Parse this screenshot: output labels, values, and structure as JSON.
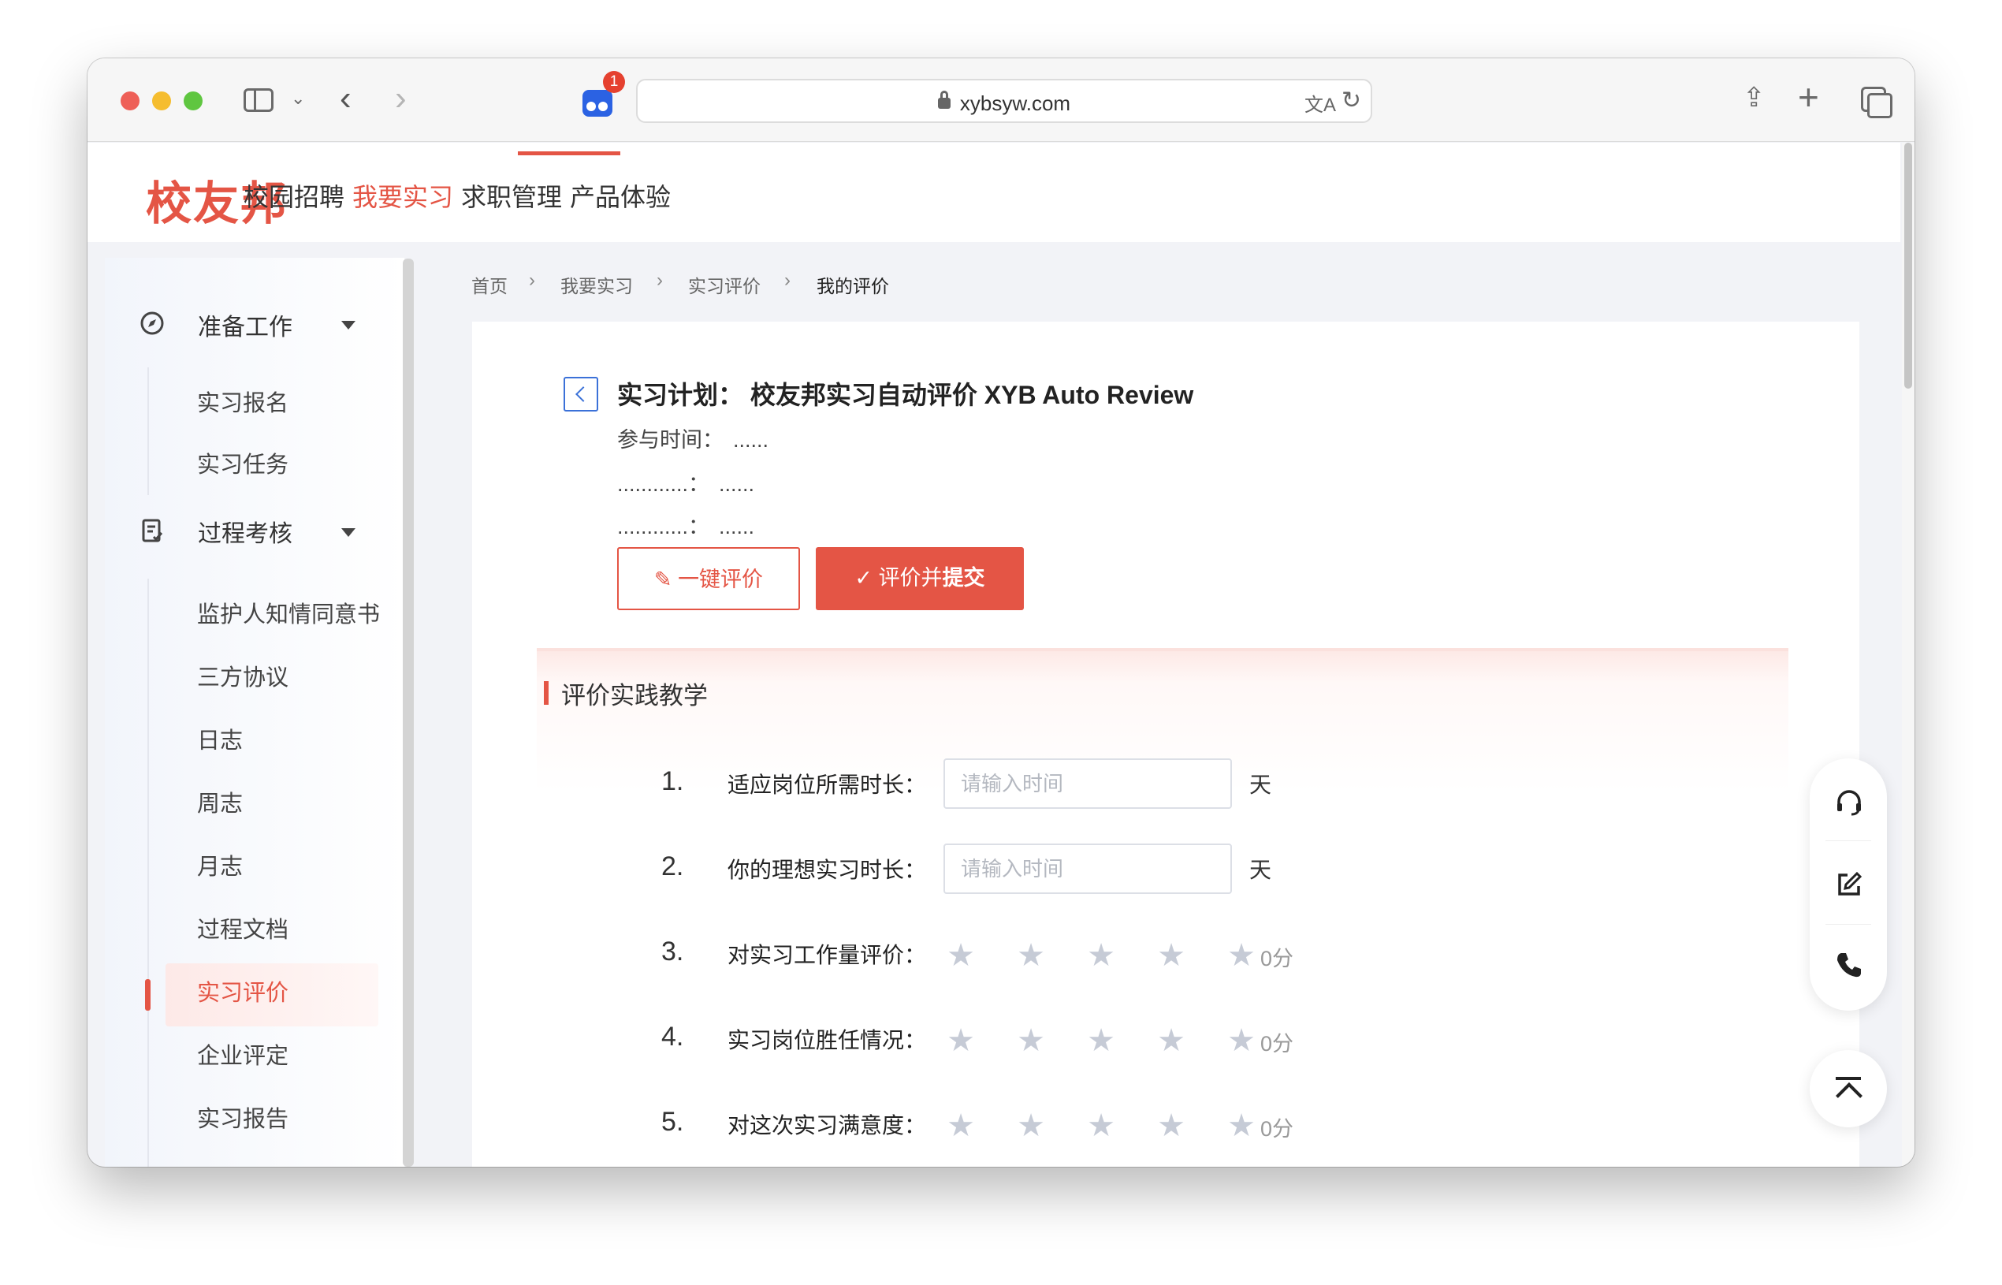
{
  "browser": {
    "url": "xybsyw.com",
    "extension_badge": "1",
    "icons": [
      "sidebar-icon",
      "chevron-down-icon",
      "back-arrow-icon",
      "forward-arrow-icon",
      "extension-icon",
      "lock-icon",
      "translate-icon",
      "reload-icon",
      "share-icon",
      "new-tab-icon",
      "tab-overview-icon"
    ]
  },
  "header": {
    "logo": "校友邦",
    "nav": [
      "校园招聘",
      "我要实习",
      "求职管理",
      "产品体验"
    ],
    "active_nav": "我要实习"
  },
  "sidebar": {
    "groups": [
      {
        "label": "准备工作",
        "icon": "compass-icon",
        "items": [
          "实习报名",
          "实习任务"
        ]
      },
      {
        "label": "过程考核",
        "icon": "checklist-icon",
        "items": [
          "监护人知情同意书",
          "三方协议",
          "日志",
          "周志",
          "月志",
          "过程文档",
          "实习评价",
          "企业评定",
          "实习报告"
        ]
      }
    ],
    "active_item": "实习评价"
  },
  "breadcrumb": [
    "首页",
    "我要实习",
    "实习评价",
    "我的评价"
  ],
  "plan": {
    "title": "实习计划：  校友邦实习自动评价 XYB Auto Review",
    "lines": [
      {
        "label": "参与时间：",
        "value": "......"
      },
      {
        "label": "............：",
        "value": "......"
      },
      {
        "label": "............：",
        "value": "......"
      }
    ],
    "btn_auto": "一键评价",
    "btn_submit_prefix": "评价并",
    "btn_submit_bold": "提交"
  },
  "section": {
    "title": "评价实践教学",
    "questions": [
      {
        "num": "1.",
        "label": "适应岗位所需时长：",
        "type": "input",
        "placeholder": "请输入时间",
        "value": "",
        "unit": "天"
      },
      {
        "num": "2.",
        "label": "你的理想实习时长：",
        "type": "input",
        "placeholder": "请输入时间",
        "value": "",
        "unit": "天"
      },
      {
        "num": "3.",
        "label": "对实习工作量评价：",
        "type": "stars",
        "rating": 0,
        "max": 5,
        "score_text": "0分"
      },
      {
        "num": "4.",
        "label": "实习岗位胜任情况：",
        "type": "stars",
        "rating": 0,
        "max": 5,
        "score_text": "0分"
      },
      {
        "num": "5.",
        "label": "对这次实习满意度：",
        "type": "stars",
        "rating": 0,
        "max": 5,
        "score_text": "0分"
      }
    ]
  },
  "floating": {
    "icons": [
      "headset-icon",
      "edit-icon",
      "phone-icon",
      "back-to-top-icon"
    ]
  },
  "colors": {
    "brand": "#e45545",
    "link_blue": "#3b71d8",
    "star_empty": "#c6cbd6"
  }
}
